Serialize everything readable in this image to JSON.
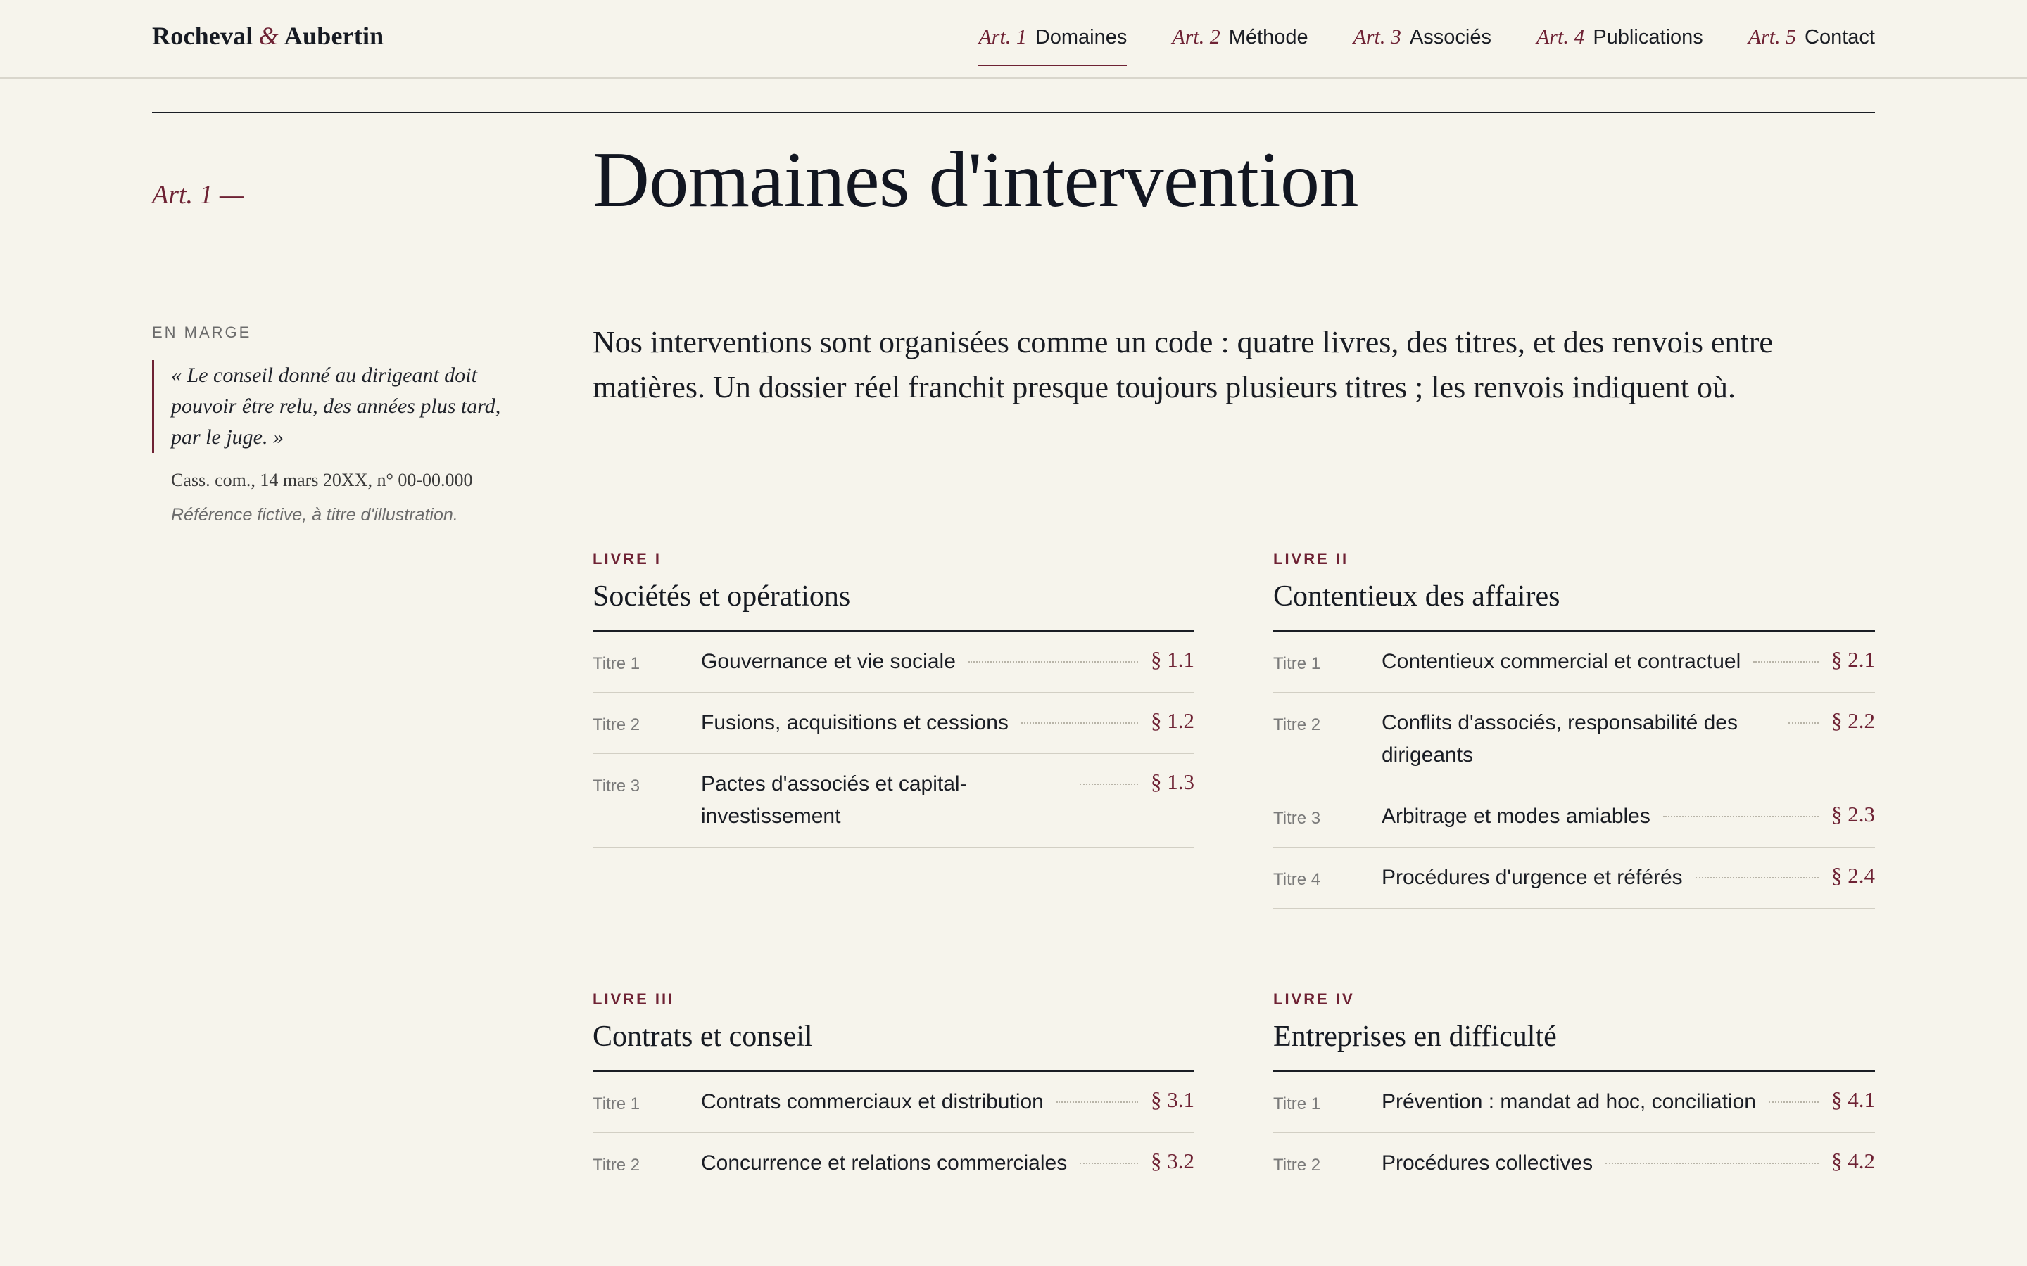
{
  "brand": {
    "first": "Rocheval",
    "amp": "&",
    "second": "Aubertin"
  },
  "nav": [
    {
      "art": "Art. 1",
      "label": "Domaines"
    },
    {
      "art": "Art. 2",
      "label": "Méthode"
    },
    {
      "art": "Art. 3",
      "label": "Associés"
    },
    {
      "art": "Art. 4",
      "label": "Publications"
    },
    {
      "art": "Art. 5",
      "label": "Contact"
    }
  ],
  "section": {
    "art_label": "Art. 1 —",
    "title": "Domaines d'intervention"
  },
  "margin": {
    "label": "En marge",
    "quote": "« Le conseil donné au dirigeant doit pouvoir être relu, des années plus tard, par le juge. »",
    "citation": "Cass. com., 14 mars 20XX, n° 00-00.000",
    "note": "Référence fictive, à titre d'illustration."
  },
  "intro": "Nos interventions sont organisées comme un code : quatre livres, des titres, et des renvois entre matières. Un dossier réel franchit presque toujours plusieurs titres ; les renvois indiquent où.",
  "livres": [
    {
      "num": "LIVRE I",
      "title": "Sociétés et opérations",
      "titres": [
        {
          "num": "Titre 1",
          "name": "Gouvernance et vie sociale",
          "sect": "§ 1.1"
        },
        {
          "num": "Titre 2",
          "name": "Fusions, acquisitions et cessions",
          "sect": "§ 1.2"
        },
        {
          "num": "Titre 3",
          "name": "Pactes d'associés et capital-investissement",
          "sect": "§ 1.3"
        }
      ]
    },
    {
      "num": "LIVRE II",
      "title": "Contentieux des affaires",
      "titres": [
        {
          "num": "Titre 1",
          "name": "Contentieux commercial et contractuel",
          "sect": "§ 2.1"
        },
        {
          "num": "Titre 2",
          "name": "Conflits d'associés, responsabilité des dirigeants",
          "sect": "§ 2.2"
        },
        {
          "num": "Titre 3",
          "name": "Arbitrage et modes amiables",
          "sect": "§ 2.3"
        },
        {
          "num": "Titre 4",
          "name": "Procédures d'urgence et référés",
          "sect": "§ 2.4"
        }
      ]
    },
    {
      "num": "LIVRE III",
      "title": "Contrats et conseil",
      "titres": [
        {
          "num": "Titre 1",
          "name": "Contrats commerciaux et distribution",
          "sect": "§ 3.1"
        },
        {
          "num": "Titre 2",
          "name": "Concurrence et relations commerciales",
          "sect": "§ 3.2"
        }
      ]
    },
    {
      "num": "LIVRE IV",
      "title": "Entreprises en difficulté",
      "titres": [
        {
          "num": "Titre 1",
          "name": "Prévention : mandat ad hoc, conciliation",
          "sect": "§ 4.1"
        },
        {
          "num": "Titre 2",
          "name": "Procédures collectives",
          "sect": "§ 4.2"
        }
      ]
    }
  ]
}
